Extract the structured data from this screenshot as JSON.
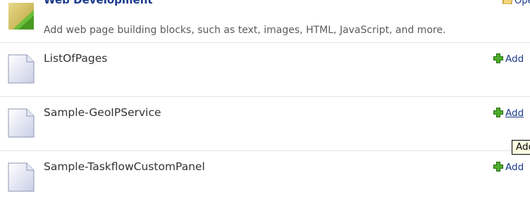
{
  "category": {
    "title": "Web Development",
    "description": "Add web page building blocks, such as text, images, HTML, JavaScript, and more.",
    "open_label": "Open",
    "icon": "web-development-icon"
  },
  "pages": [
    {
      "name": "ListOfPages",
      "add_label": "Add",
      "icon": "page-icon"
    },
    {
      "name": "Sample-GeoIPService",
      "add_label": "Add",
      "icon": "page-icon"
    },
    {
      "name": "Sample-TaskflowCustomPanel",
      "add_label": "Add",
      "icon": "page-icon"
    }
  ],
  "tooltip": {
    "text": "Add"
  },
  "colors": {
    "link": "#1a3a8c",
    "add_icon": "#3a9a1a",
    "divider": "#dfe3e8",
    "tooltip_bg": "#ffffe1"
  }
}
